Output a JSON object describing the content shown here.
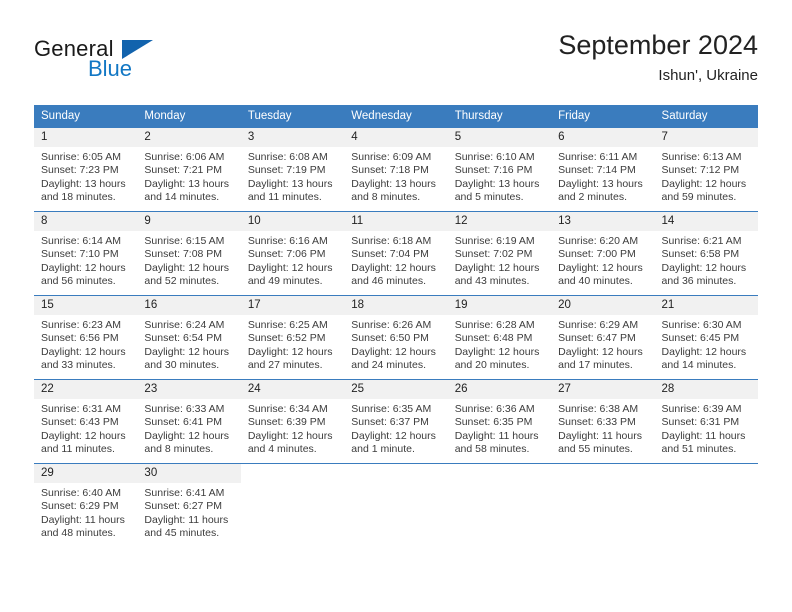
{
  "brand": {
    "name_part1": "General",
    "name_part2": "Blue"
  },
  "header": {
    "title": "September 2024",
    "location": "Ishun', Ukraine"
  },
  "colors": {
    "header_blue": "#3a7cbe",
    "brand_blue": "#1277c4",
    "daynum_background": "#f1f1f1"
  },
  "weekdays": [
    "Sunday",
    "Monday",
    "Tuesday",
    "Wednesday",
    "Thursday",
    "Friday",
    "Saturday"
  ],
  "weeks": [
    [
      {
        "day": "1",
        "sunrise": "Sunrise: 6:05 AM",
        "sunset": "Sunset: 7:23 PM",
        "daylight1": "Daylight: 13 hours",
        "daylight2": "and 18 minutes."
      },
      {
        "day": "2",
        "sunrise": "Sunrise: 6:06 AM",
        "sunset": "Sunset: 7:21 PM",
        "daylight1": "Daylight: 13 hours",
        "daylight2": "and 14 minutes."
      },
      {
        "day": "3",
        "sunrise": "Sunrise: 6:08 AM",
        "sunset": "Sunset: 7:19 PM",
        "daylight1": "Daylight: 13 hours",
        "daylight2": "and 11 minutes."
      },
      {
        "day": "4",
        "sunrise": "Sunrise: 6:09 AM",
        "sunset": "Sunset: 7:18 PM",
        "daylight1": "Daylight: 13 hours",
        "daylight2": "and 8 minutes."
      },
      {
        "day": "5",
        "sunrise": "Sunrise: 6:10 AM",
        "sunset": "Sunset: 7:16 PM",
        "daylight1": "Daylight: 13 hours",
        "daylight2": "and 5 minutes."
      },
      {
        "day": "6",
        "sunrise": "Sunrise: 6:11 AM",
        "sunset": "Sunset: 7:14 PM",
        "daylight1": "Daylight: 13 hours",
        "daylight2": "and 2 minutes."
      },
      {
        "day": "7",
        "sunrise": "Sunrise: 6:13 AM",
        "sunset": "Sunset: 7:12 PM",
        "daylight1": "Daylight: 12 hours",
        "daylight2": "and 59 minutes."
      }
    ],
    [
      {
        "day": "8",
        "sunrise": "Sunrise: 6:14 AM",
        "sunset": "Sunset: 7:10 PM",
        "daylight1": "Daylight: 12 hours",
        "daylight2": "and 56 minutes."
      },
      {
        "day": "9",
        "sunrise": "Sunrise: 6:15 AM",
        "sunset": "Sunset: 7:08 PM",
        "daylight1": "Daylight: 12 hours",
        "daylight2": "and 52 minutes."
      },
      {
        "day": "10",
        "sunrise": "Sunrise: 6:16 AM",
        "sunset": "Sunset: 7:06 PM",
        "daylight1": "Daylight: 12 hours",
        "daylight2": "and 49 minutes."
      },
      {
        "day": "11",
        "sunrise": "Sunrise: 6:18 AM",
        "sunset": "Sunset: 7:04 PM",
        "daylight1": "Daylight: 12 hours",
        "daylight2": "and 46 minutes."
      },
      {
        "day": "12",
        "sunrise": "Sunrise: 6:19 AM",
        "sunset": "Sunset: 7:02 PM",
        "daylight1": "Daylight: 12 hours",
        "daylight2": "and 43 minutes."
      },
      {
        "day": "13",
        "sunrise": "Sunrise: 6:20 AM",
        "sunset": "Sunset: 7:00 PM",
        "daylight1": "Daylight: 12 hours",
        "daylight2": "and 40 minutes."
      },
      {
        "day": "14",
        "sunrise": "Sunrise: 6:21 AM",
        "sunset": "Sunset: 6:58 PM",
        "daylight1": "Daylight: 12 hours",
        "daylight2": "and 36 minutes."
      }
    ],
    [
      {
        "day": "15",
        "sunrise": "Sunrise: 6:23 AM",
        "sunset": "Sunset: 6:56 PM",
        "daylight1": "Daylight: 12 hours",
        "daylight2": "and 33 minutes."
      },
      {
        "day": "16",
        "sunrise": "Sunrise: 6:24 AM",
        "sunset": "Sunset: 6:54 PM",
        "daylight1": "Daylight: 12 hours",
        "daylight2": "and 30 minutes."
      },
      {
        "day": "17",
        "sunrise": "Sunrise: 6:25 AM",
        "sunset": "Sunset: 6:52 PM",
        "daylight1": "Daylight: 12 hours",
        "daylight2": "and 27 minutes."
      },
      {
        "day": "18",
        "sunrise": "Sunrise: 6:26 AM",
        "sunset": "Sunset: 6:50 PM",
        "daylight1": "Daylight: 12 hours",
        "daylight2": "and 24 minutes."
      },
      {
        "day": "19",
        "sunrise": "Sunrise: 6:28 AM",
        "sunset": "Sunset: 6:48 PM",
        "daylight1": "Daylight: 12 hours",
        "daylight2": "and 20 minutes."
      },
      {
        "day": "20",
        "sunrise": "Sunrise: 6:29 AM",
        "sunset": "Sunset: 6:47 PM",
        "daylight1": "Daylight: 12 hours",
        "daylight2": "and 17 minutes."
      },
      {
        "day": "21",
        "sunrise": "Sunrise: 6:30 AM",
        "sunset": "Sunset: 6:45 PM",
        "daylight1": "Daylight: 12 hours",
        "daylight2": "and 14 minutes."
      }
    ],
    [
      {
        "day": "22",
        "sunrise": "Sunrise: 6:31 AM",
        "sunset": "Sunset: 6:43 PM",
        "daylight1": "Daylight: 12 hours",
        "daylight2": "and 11 minutes."
      },
      {
        "day": "23",
        "sunrise": "Sunrise: 6:33 AM",
        "sunset": "Sunset: 6:41 PM",
        "daylight1": "Daylight: 12 hours",
        "daylight2": "and 8 minutes."
      },
      {
        "day": "24",
        "sunrise": "Sunrise: 6:34 AM",
        "sunset": "Sunset: 6:39 PM",
        "daylight1": "Daylight: 12 hours",
        "daylight2": "and 4 minutes."
      },
      {
        "day": "25",
        "sunrise": "Sunrise: 6:35 AM",
        "sunset": "Sunset: 6:37 PM",
        "daylight1": "Daylight: 12 hours",
        "daylight2": "and 1 minute."
      },
      {
        "day": "26",
        "sunrise": "Sunrise: 6:36 AM",
        "sunset": "Sunset: 6:35 PM",
        "daylight1": "Daylight: 11 hours",
        "daylight2": "and 58 minutes."
      },
      {
        "day": "27",
        "sunrise": "Sunrise: 6:38 AM",
        "sunset": "Sunset: 6:33 PM",
        "daylight1": "Daylight: 11 hours",
        "daylight2": "and 55 minutes."
      },
      {
        "day": "28",
        "sunrise": "Sunrise: 6:39 AM",
        "sunset": "Sunset: 6:31 PM",
        "daylight1": "Daylight: 11 hours",
        "daylight2": "and 51 minutes."
      }
    ],
    [
      {
        "day": "29",
        "sunrise": "Sunrise: 6:40 AM",
        "sunset": "Sunset: 6:29 PM",
        "daylight1": "Daylight: 11 hours",
        "daylight2": "and 48 minutes."
      },
      {
        "day": "30",
        "sunrise": "Sunrise: 6:41 AM",
        "sunset": "Sunset: 6:27 PM",
        "daylight1": "Daylight: 11 hours",
        "daylight2": "and 45 minutes."
      },
      {
        "day": "",
        "sunrise": "",
        "sunset": "",
        "daylight1": "",
        "daylight2": ""
      },
      {
        "day": "",
        "sunrise": "",
        "sunset": "",
        "daylight1": "",
        "daylight2": ""
      },
      {
        "day": "",
        "sunrise": "",
        "sunset": "",
        "daylight1": "",
        "daylight2": ""
      },
      {
        "day": "",
        "sunrise": "",
        "sunset": "",
        "daylight1": "",
        "daylight2": ""
      },
      {
        "day": "",
        "sunrise": "",
        "sunset": "",
        "daylight1": "",
        "daylight2": ""
      }
    ]
  ]
}
